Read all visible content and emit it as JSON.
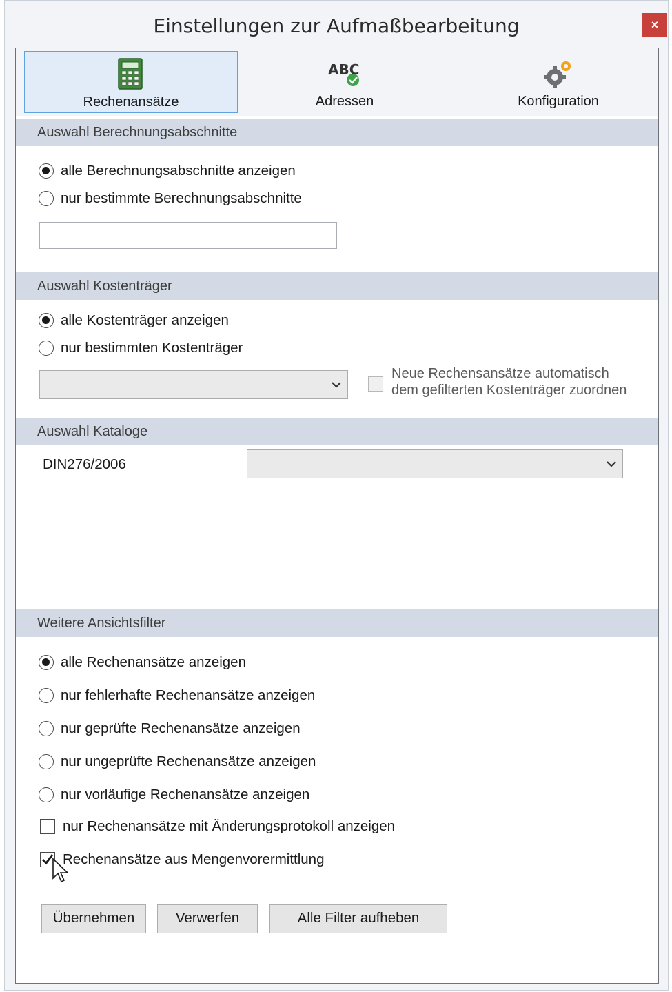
{
  "window": {
    "title": "Einstellungen zur Aufmaßbearbeitung",
    "close_label": "×"
  },
  "tabs": [
    {
      "label": "Rechenansätze",
      "icon": "calculator-icon",
      "active": true
    },
    {
      "label": "Adressen",
      "icon": "abc-spellcheck-icon",
      "active": false
    },
    {
      "label": "Konfiguration",
      "icon": "gears-icon",
      "active": false
    }
  ],
  "sections": {
    "berechnungsabschnitte": {
      "header": "Auswahl Berechnungsabschnitte",
      "option_all": "alle Berechnungsabschnitte anzeigen",
      "option_some": "nur bestimmte Berechnungsabschnitte",
      "selected": "all",
      "input_value": ""
    },
    "kostentraeger": {
      "header": "Auswahl Kostenträger",
      "option_all": "alle Kostenträger anzeigen",
      "option_some": "nur bestimmten Kostenträger",
      "selected": "all",
      "select_value": "",
      "auto_assign_line1": "Neue Rechensansätze automatisch",
      "auto_assign_line2": "dem gefilterten Kostenträger zuordnen",
      "auto_assign_checked": false,
      "auto_assign_enabled": false
    },
    "kataloge": {
      "header": "Auswahl Kataloge",
      "catalog_label": "DIN276/2006",
      "catalog_value": ""
    },
    "ansichtsfilter": {
      "header": "Weitere Ansichtsfilter",
      "options": [
        "alle Rechenansätze anzeigen",
        "nur fehlerhafte Rechenansätze anzeigen",
        "nur geprüfte Rechenansätze anzeigen",
        "nur ungeprüfte Rechenansätze anzeigen",
        "nur vorläufige Rechenansätze anzeigen"
      ],
      "selected_index": 0,
      "check_protocol": "nur Rechenansätze mit Änderungsprotokoll anzeigen",
      "check_protocol_checked": false,
      "check_mengen": "Rechenansätze aus Mengenvorermittlung",
      "check_mengen_checked": true
    }
  },
  "buttons": {
    "apply": "Übernehmen",
    "discard": "Verwerfen",
    "clear_filters": "Alle Filter aufheben"
  },
  "colors": {
    "accent": "#5ea2e0",
    "close": "#c7403a",
    "section_bg": "#d3dae5"
  }
}
